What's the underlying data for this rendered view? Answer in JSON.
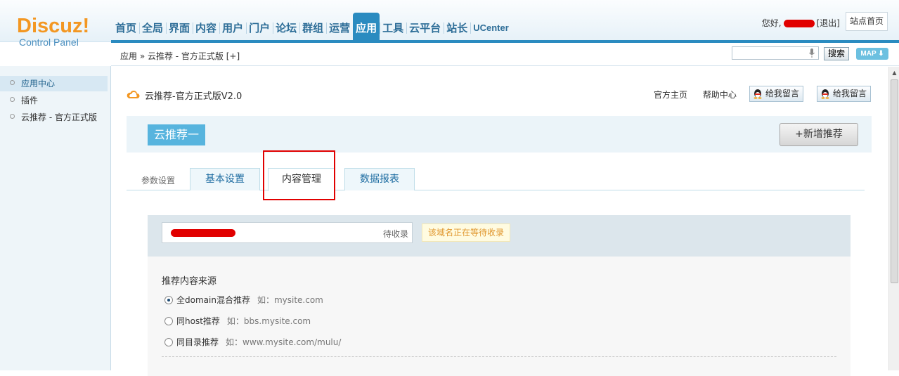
{
  "header": {
    "logo_brand": "Discuz!",
    "logo_sub": "Control Panel",
    "nav": [
      {
        "label": "首页"
      },
      {
        "label": "全局"
      },
      {
        "label": "界面"
      },
      {
        "label": "内容"
      },
      {
        "label": "用户"
      },
      {
        "label": "门户"
      },
      {
        "label": "论坛"
      },
      {
        "label": "群组"
      },
      {
        "label": "运营"
      },
      {
        "label": "应用",
        "active": true
      },
      {
        "label": "工具"
      },
      {
        "label": "云平台"
      },
      {
        "label": "站长"
      },
      {
        "label": "UCenter"
      }
    ],
    "greeting": "您好,",
    "logout": "[退出]",
    "site_home": "站点首页"
  },
  "subbar": {
    "breadcrumb": "应用 » 云推荐 - 官方正式版  [+]",
    "search_value": "",
    "search_button": "搜索",
    "map_button": "MAP"
  },
  "sidebar": {
    "items": [
      {
        "label": "应用中心",
        "active": true
      },
      {
        "label": "插件"
      },
      {
        "label": "云推荐 - 官方正式版"
      }
    ]
  },
  "main": {
    "plugin_title": "云推荐-官方正式版V2.0",
    "links": [
      "官方主页",
      "帮助中心"
    ],
    "qq_buttons": [
      "给我留言",
      "给我留言"
    ],
    "banner_title": "云推荐一",
    "add_button": "+新增推荐",
    "tab_prefix": "参数设置",
    "tabs": [
      {
        "label": "基本设置"
      },
      {
        "label": "内容管理",
        "active": true
      },
      {
        "label": "数据报表"
      }
    ],
    "domain_status": "待收录",
    "domain_tip": "该域名正在等待收录",
    "source_label": "推荐内容来源",
    "source_options": [
      {
        "label": "全domain混合推荐",
        "example": "如：mysite.com",
        "checked": true
      },
      {
        "label": "同host推荐",
        "example": "如：bbs.mysite.com",
        "checked": false
      },
      {
        "label": "同目录推荐",
        "example": "如：www.mysite.com/mulu/",
        "checked": false
      }
    ]
  },
  "colors": {
    "accent": "#2a8bc0",
    "logo_orange": "#f39722",
    "highlight_red": "#e10000"
  }
}
